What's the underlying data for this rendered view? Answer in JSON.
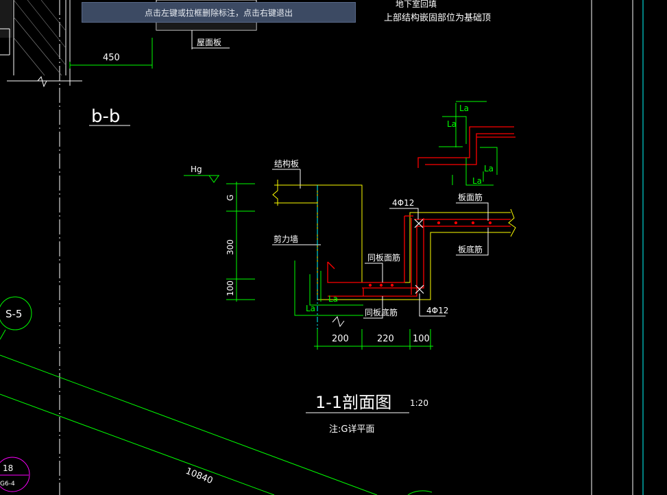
{
  "hint_bar": {
    "text": "点击左键或拉框删除标注，点击右键退出"
  },
  "top_note": {
    "line1": "上部结构嵌固部位为基础顶",
    "partial_above": "地下室回填"
  },
  "labels": {
    "roof_slab": "屋面板",
    "dim_450": "450",
    "section_bb": "b-b",
    "hg": "Hg",
    "structural_slab": "结构板",
    "g": "G",
    "shear_wall": "剪力墙",
    "dim_300": "300",
    "dim_100_left": "100",
    "la_1": "La",
    "la_2": "La",
    "la_3": "La",
    "la_4": "La",
    "la_5": "La",
    "la_6": "La",
    "rebar_top": "4Φ12",
    "rebar_bottom": "4Φ12",
    "slab_top_bar": "板面筋",
    "slab_bottom_bar": "板底筋",
    "same_top_bar": "同板面筋",
    "same_bottom_bar": "同板底筋",
    "dim_200": "200",
    "dim_220": "220",
    "dim_100_right": "100",
    "section_title": "1-1剖面图",
    "scale": "1:20",
    "note": "注:G详平面",
    "grid_s5": "S-5",
    "detail_num": "18",
    "detail_ref": "G6-4",
    "dim_10840": "10840"
  },
  "colors": {
    "background": "#000000",
    "lines_white": "#ffffff",
    "structure_yellow": "#ffff00",
    "rebar_red": "#ff0000",
    "dim_green": "#00ff00",
    "grid_cyan": "#00ffff",
    "bubble_magenta": "#ff00ff",
    "hint_bg": "#3c4a63"
  }
}
